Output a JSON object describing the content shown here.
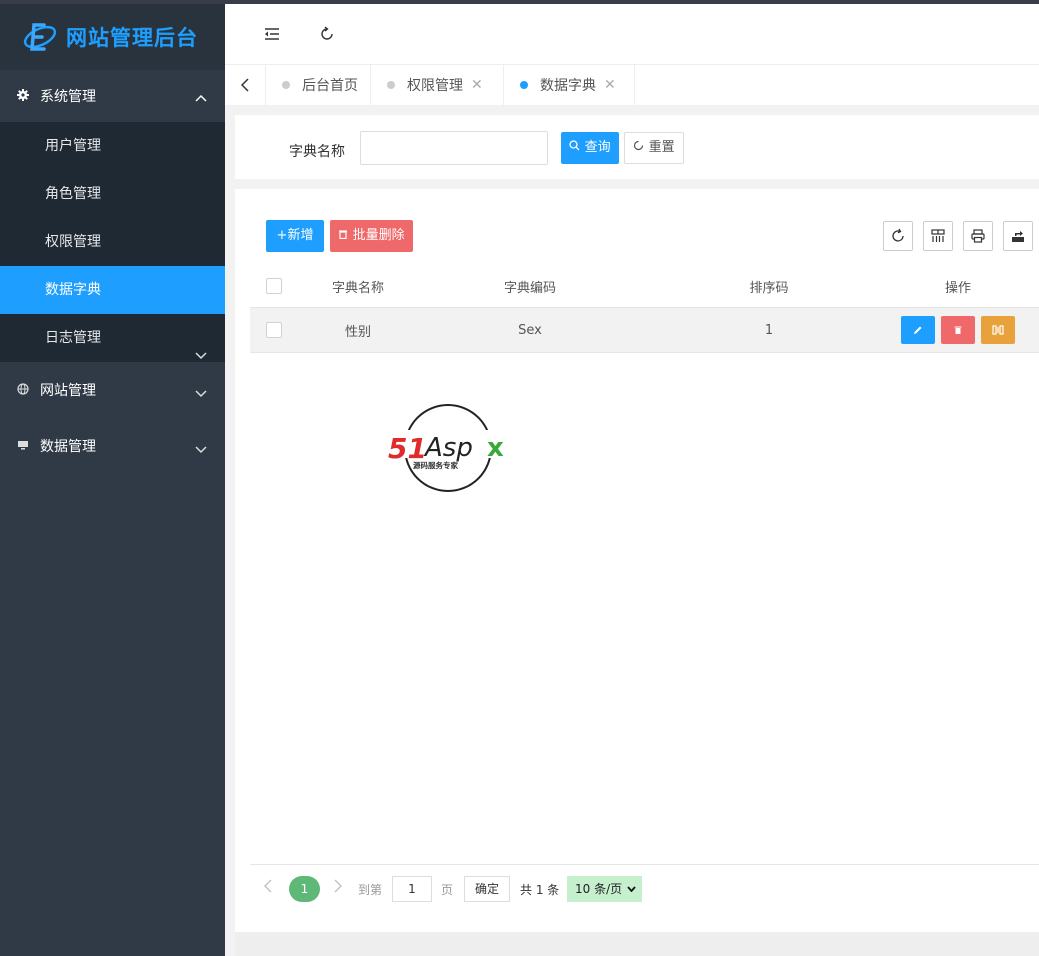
{
  "app": {
    "title": "网站管理后台"
  },
  "sidebar": {
    "groups": [
      {
        "label": "系统管理",
        "icon": "gear-icon",
        "expanded": true,
        "items": [
          {
            "label": "用户管理"
          },
          {
            "label": "角色管理"
          },
          {
            "label": "权限管理"
          },
          {
            "label": "数据字典",
            "active": true
          },
          {
            "label": "日志管理",
            "has_children": true
          }
        ]
      },
      {
        "label": "网站管理",
        "icon": "globe-icon",
        "expanded": false
      },
      {
        "label": "数据管理",
        "icon": "monitor-icon",
        "expanded": false
      }
    ]
  },
  "header": {
    "icons": [
      "menu-fold-icon",
      "refresh-icon"
    ]
  },
  "tabs": [
    {
      "label": "后台首页",
      "closable": false,
      "active": false
    },
    {
      "label": "权限管理",
      "closable": true,
      "active": false
    },
    {
      "label": "数据字典",
      "closable": true,
      "active": true
    }
  ],
  "search": {
    "label": "字典名称",
    "value": "",
    "placeholder": "",
    "query_label": "查询",
    "reset_label": "重置"
  },
  "toolbar": {
    "add_label": "+新增",
    "batch_delete_label": "批量删除",
    "tools": [
      "refresh-icon",
      "columns-icon",
      "print-icon",
      "export-icon"
    ]
  },
  "table": {
    "columns": [
      "字典名称",
      "字典编码",
      "排序码",
      "操作"
    ],
    "rows": [
      {
        "name": "性别",
        "code": "Sex",
        "sort": "1"
      }
    ]
  },
  "pager": {
    "current": "1",
    "goto_label": "到第",
    "page_value": "1",
    "page_suffix": "页",
    "confirm_label": "确定",
    "total_label": "共 1 条",
    "page_size": "10 条/页"
  },
  "watermark": {
    "brand": "51Aspx",
    "slogan": "源码服务专家"
  },
  "colors": {
    "primary": "#1E9FFF",
    "danger": "#f0696a",
    "warning": "#e9a23b",
    "sidebar": "#2f3a46",
    "pager_active": "#5fb878"
  }
}
